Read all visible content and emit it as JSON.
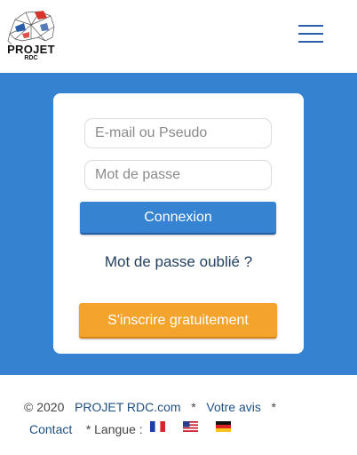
{
  "header": {
    "logo": {
      "title": "PROJET",
      "subtitle": "RDC"
    },
    "menu_icon": "hamburger-menu-icon",
    "colors": {
      "menu": "#2a5ea8"
    }
  },
  "login": {
    "email_placeholder": "E-mail ou Pseudo",
    "password_placeholder": "Mot de passe",
    "login_label": "Connexion",
    "forgot_label": "Mot de passe oublié ?",
    "signup_label": "S'inscrire gratuitement",
    "colors": {
      "band": "#3582d1",
      "login_button": "#3683d2",
      "signup_button": "#f4a42d"
    }
  },
  "footer": {
    "copyright": "© 2020",
    "site_link": "PROJET RDC.com",
    "separator": "*",
    "feedback_link": "Votre avis",
    "contact_link": "Contact",
    "language_label": "* Langue :",
    "flags": [
      "flag-france-icon",
      "flag-usa-icon",
      "flag-germany-icon"
    ]
  }
}
